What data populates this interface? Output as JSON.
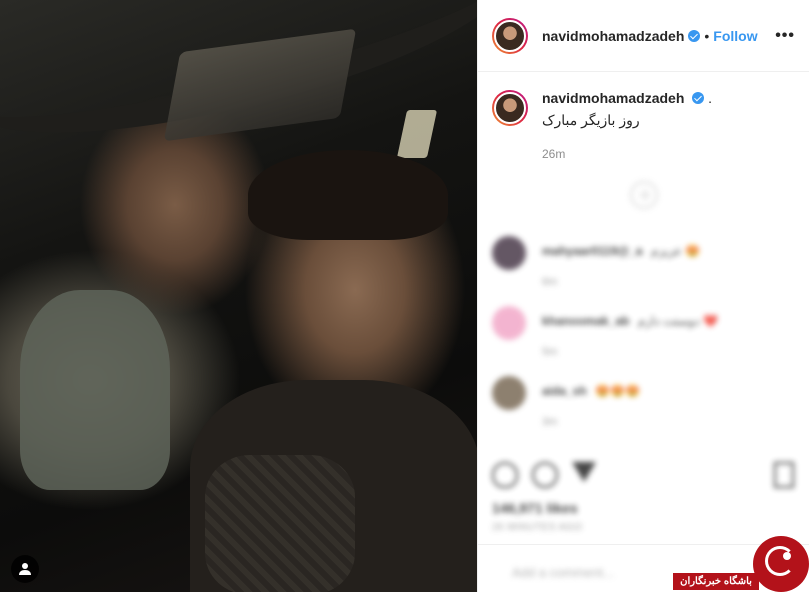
{
  "post": {
    "username": "navidmohamadzadeh",
    "verified": true,
    "separator": "•",
    "follow_label": "Follow",
    "more_icon": "more-options-icon"
  },
  "caption": {
    "username": "navidmohamadzadeh",
    "dot": ".",
    "text": "روز بازیگر مبارک",
    "time": "26m"
  },
  "comments": [
    {
      "name": "mahyaar0119@_a",
      "text": "عزیزم 😍",
      "time": "6m",
      "avatar_color": "#4a3a4a"
    },
    {
      "name": "khanoomak_ab",
      "text": "دوستت دارم ❤️",
      "time": "5m",
      "avatar_color": "#f2a8c8"
    },
    {
      "name": "aida_sh",
      "text": "😍😍😍",
      "time": "3m",
      "avatar_color": "#7a6a56"
    }
  ],
  "footer": {
    "likes": "146,971 likes",
    "posted": "26 MINUTES AGO",
    "add_comment_placeholder": "Add a comment..."
  },
  "watermark": {
    "label": "باشگاه خبرنگاران"
  },
  "colors": {
    "accent": "#3897f0",
    "watermark": "#b3121a"
  }
}
